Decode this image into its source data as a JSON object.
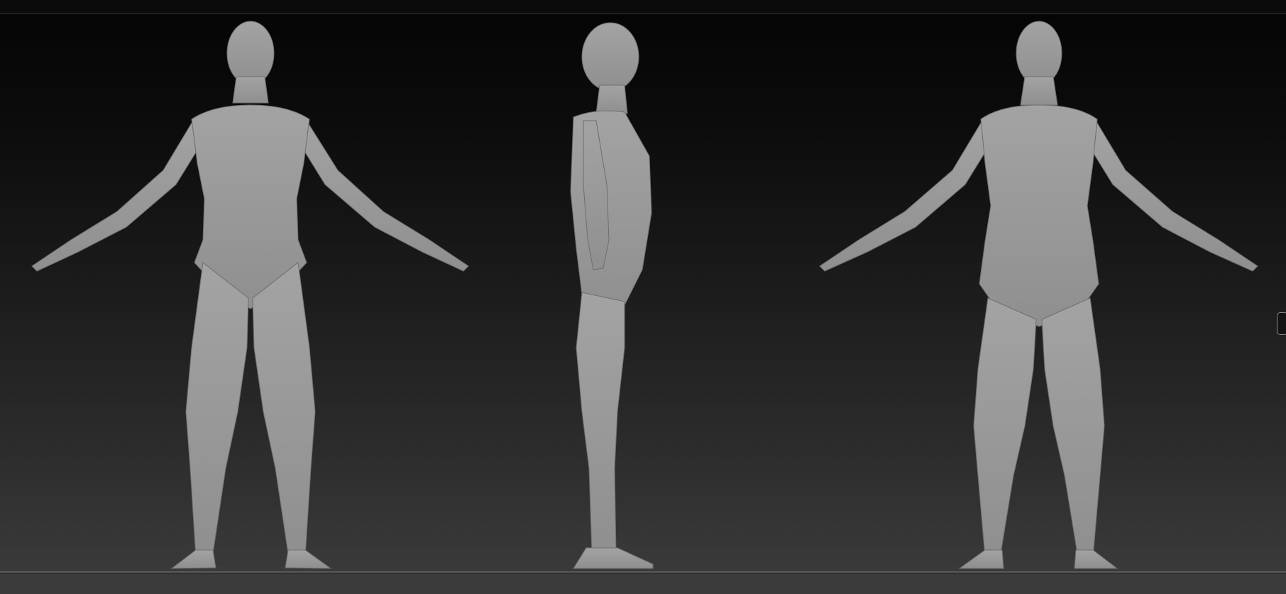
{
  "viewport": {
    "views": [
      {
        "id": "front",
        "figure": "front-view"
      },
      {
        "id": "side",
        "figure": "side-view"
      },
      {
        "id": "back",
        "figure": "back-view"
      }
    ]
  },
  "icons": {
    "side_handle": "panel-resize-handle"
  },
  "colors": {
    "background_top": "#050505",
    "background_bottom": "#3a3a3a",
    "clay": "#9a9a9a",
    "separator": "#5a5a5a"
  }
}
